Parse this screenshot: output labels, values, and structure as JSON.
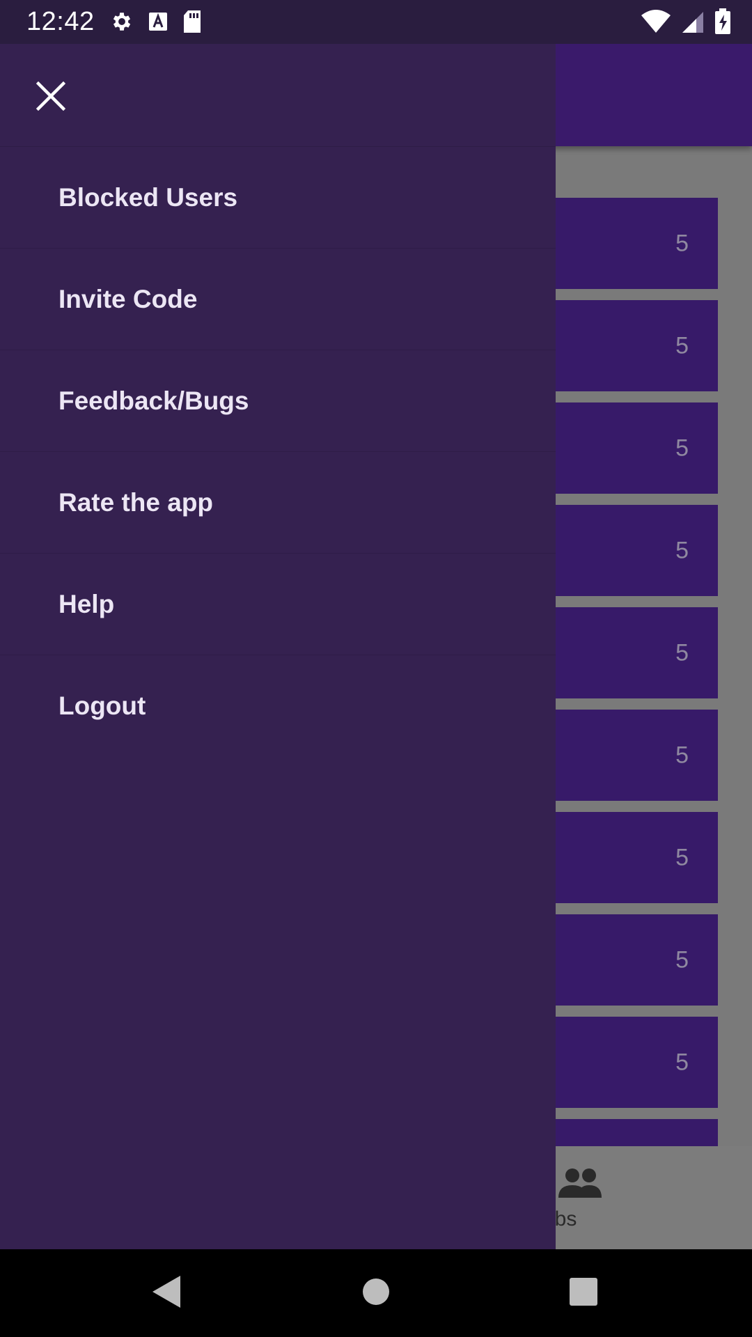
{
  "status_bar": {
    "time": "12:42",
    "left_icons": [
      "gear-icon",
      "keyboard-a-icon",
      "sd-card-icon"
    ],
    "right_icons": [
      "wifi-icon",
      "cell-signal-icon",
      "battery-charging-icon"
    ]
  },
  "drawer": {
    "close_icon": "close-icon",
    "items": [
      {
        "label": "Blocked Users"
      },
      {
        "label": "Invite Code"
      },
      {
        "label": "Feedback/Bugs"
      },
      {
        "label": "Rate the app"
      },
      {
        "label": "Help"
      },
      {
        "label": "Logout"
      }
    ]
  },
  "background_list": {
    "items": [
      {
        "count": "5"
      },
      {
        "count": "5"
      },
      {
        "count": "5"
      },
      {
        "count": "5"
      },
      {
        "count": "5"
      },
      {
        "count": "5"
      },
      {
        "count": "5"
      },
      {
        "count": "5"
      },
      {
        "count": "5"
      }
    ]
  },
  "bottom_nav": {
    "visible_tab_label": "ubs",
    "visible_tab_icon": "people-icon"
  },
  "navigation_bar": {
    "buttons": [
      "back-icon",
      "home-icon",
      "recents-icon"
    ]
  },
  "colors": {
    "drawer_bg": "#352150",
    "app_bar": "#3a1a6b",
    "list_item": "#371a69",
    "status_bar": "#2a1d3f"
  }
}
